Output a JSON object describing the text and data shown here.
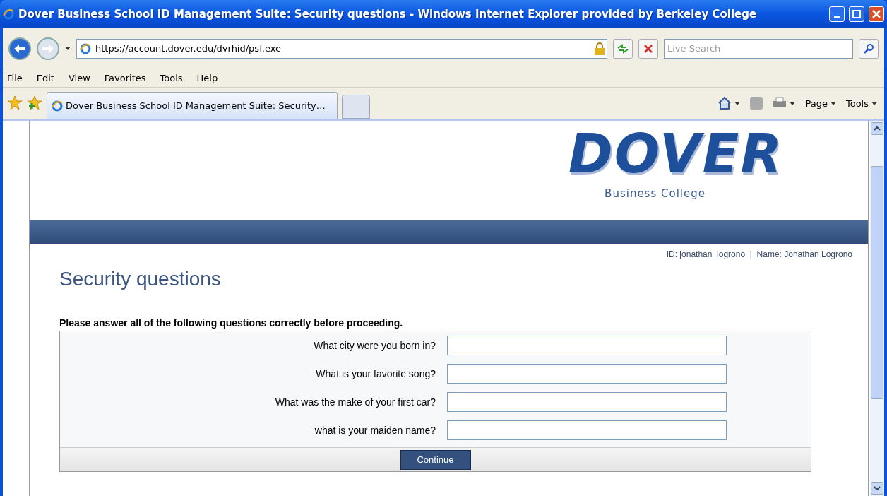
{
  "window": {
    "title": "Dover Business School ID Management Suite: Security questions - Windows Internet Explorer provided by Berkeley College"
  },
  "address_bar": {
    "url": "https://account.dover.edu/dvrhid/psf.exe",
    "search_placeholder": "Live Search"
  },
  "menu": [
    "File",
    "Edit",
    "View",
    "Favorites",
    "Tools",
    "Help"
  ],
  "tabs": [
    {
      "label": "Dover Business School ID Management Suite: Security…",
      "selected": true
    }
  ],
  "command_bar": [
    {
      "label": "Page"
    },
    {
      "label": "Tools"
    }
  ],
  "page": {
    "logo": {
      "title": "DOVER",
      "subtitle": "Business College"
    },
    "user_info": "ID: jonathan_logrono  |  Name: Jonathan Logrono",
    "heading": "Security questions",
    "instructions": "Please answer all of the following questions correctly before proceeding.",
    "questions": [
      {
        "label": "What city were you born in?"
      },
      {
        "label": "What is your favorite song?"
      },
      {
        "label": "What was the make of your first car?"
      },
      {
        "label": "what is your maiden name?"
      }
    ],
    "submit": "Continue"
  }
}
